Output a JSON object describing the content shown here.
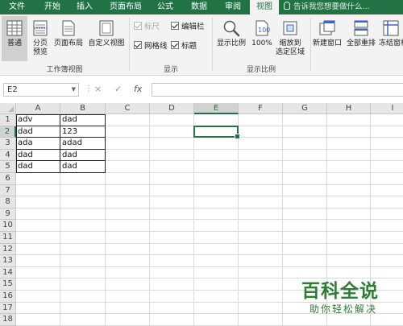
{
  "tabs": [
    {
      "label": "文件",
      "active": false
    },
    {
      "label": "开始",
      "active": false
    },
    {
      "label": "插入",
      "active": false
    },
    {
      "label": "页面布局",
      "active": false
    },
    {
      "label": "公式",
      "active": false
    },
    {
      "label": "数据",
      "active": false
    },
    {
      "label": "审阅",
      "active": false
    },
    {
      "label": "视图",
      "active": true
    }
  ],
  "tell_me": "告诉我您想要做什么...",
  "ribbon": {
    "workbook_views": {
      "group_label": "工作簿视图",
      "normal": "普通",
      "page_break_preview_1": "分页",
      "page_break_preview_2": "预览",
      "page_layout": "页面布局",
      "custom_views": "自定义视图"
    },
    "show": {
      "group_label": "显示",
      "ruler": "标尺",
      "formula_bar": "编辑栏",
      "gridlines": "网格线",
      "headings": "标题"
    },
    "zoom": {
      "group_label": "显示比例",
      "zoom": "显示比例",
      "hundred": "100%",
      "zoom_selection_1": "缩放到",
      "zoom_selection_2": "选定区域"
    },
    "window": {
      "new_window": "新建窗口",
      "arrange_all": "全部重排",
      "freeze_panes": "冻结窗格"
    }
  },
  "formula_bar": {
    "name_box": "E2",
    "cancel_icon": "×",
    "enter_icon": "✓",
    "fx": "fx",
    "value": ""
  },
  "columns": [
    "A",
    "B",
    "C",
    "D",
    "E",
    "F",
    "G",
    "H",
    "I"
  ],
  "rows": [
    "1",
    "2",
    "3",
    "4",
    "5",
    "6",
    "7",
    "8",
    "9",
    "10",
    "11",
    "12",
    "13",
    "14",
    "15",
    "16",
    "17",
    "18"
  ],
  "cells": [
    [
      "adv",
      "dad"
    ],
    [
      "dad",
      "123"
    ],
    [
      "ada",
      "adad"
    ],
    [
      "dad",
      "dad"
    ],
    [
      "dad",
      "dad"
    ]
  ],
  "active_cell": "E2",
  "colors": {
    "accent": "#217346",
    "watermark": "#2e7d32"
  },
  "watermark": {
    "title": "百科全说",
    "subtitle": "助你轻松解决"
  }
}
